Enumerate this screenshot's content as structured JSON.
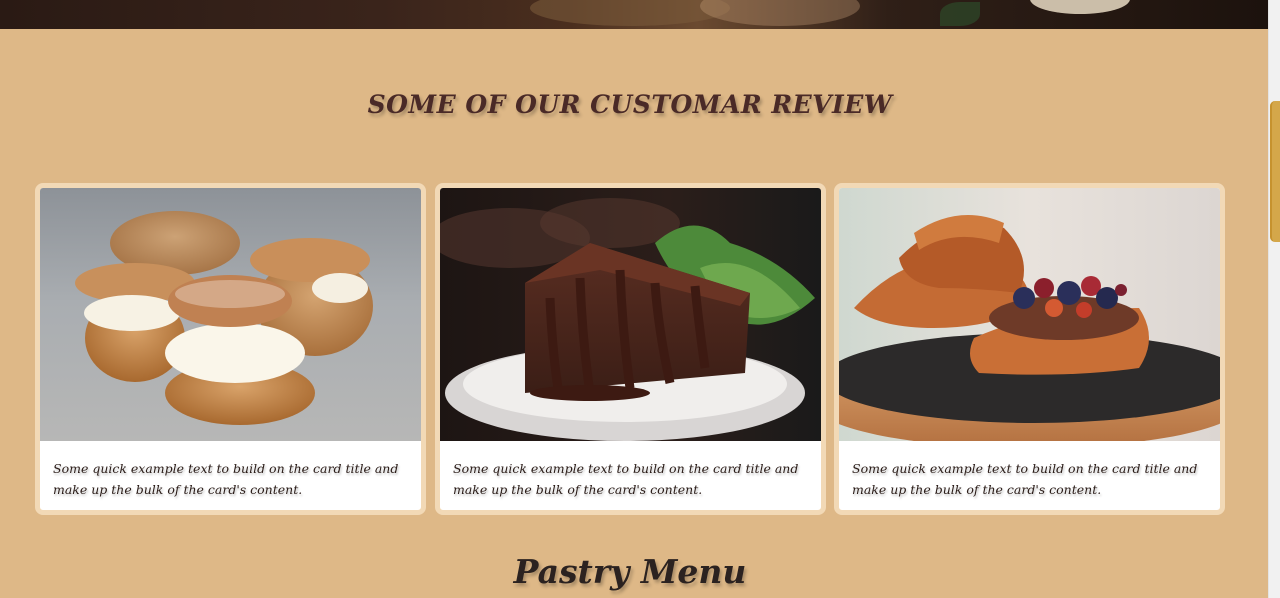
{
  "reviews": {
    "title": "SOME OF OUR CUSTOMAR REVIEW",
    "cards": [
      {
        "image": "cream-puffs-image",
        "text": "Some quick example text to build on the card title and make up the bulk of the card's content."
      },
      {
        "image": "chocolate-cake-image",
        "text": "Some quick example text to build on the card title and make up the bulk of the card's content."
      },
      {
        "image": "croissant-pastry-image",
        "text": "Some quick example text to build on the card title and make up the bulk of the card's content."
      }
    ]
  },
  "menu": {
    "title": "Pastry  Menu"
  },
  "colors": {
    "background": "#deb887",
    "card_border": "#f2d9b6",
    "heading": "#4a2a27",
    "scroll_thumb": "#d4a74a"
  }
}
